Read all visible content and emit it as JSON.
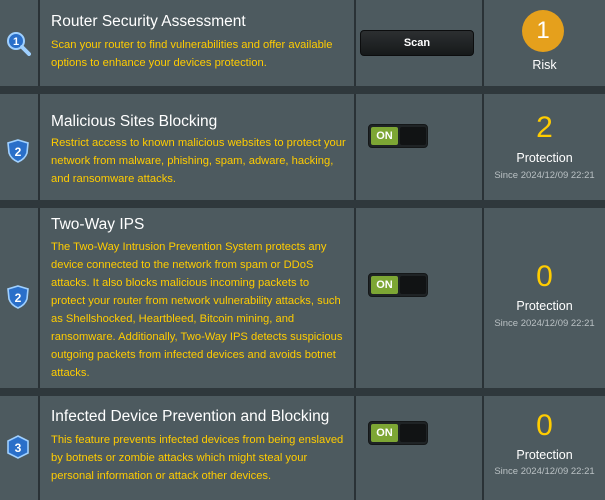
{
  "rows": [
    {
      "icon": "magnifier-1-icon",
      "icon_number": "1",
      "title": "Router Security Assessment",
      "description": "Scan your router to find vulnerabilities and offer available options to enhance your devices protection.",
      "button_label": "Scan",
      "status_value": "1",
      "status_label": "Risk"
    },
    {
      "icon": "shield-2-icon",
      "icon_number": "2",
      "title": "Malicious Sites Blocking",
      "description": "Restrict access to known malicious websites to protect your network from malware, phishing, spam, adware, hacking, and ransomware attacks.",
      "toggle_label": "ON",
      "status_value": "2",
      "status_label": "Protection",
      "since": "Since 2024/12/09 22:21"
    },
    {
      "icon": "shield-2-icon",
      "icon_number": "2",
      "title": "Two-Way IPS",
      "description": "The Two-Way Intrusion Prevention System protects any device connected to the network from spam or DDoS attacks. It also blocks malicious incoming packets to protect your router from network vulnerability attacks, such as Shellshocked, Heartbleed, Bitcoin mining, and ransomware. Additionally, Two-Way IPS detects suspicious outgoing packets from infected devices and avoids botnet attacks.",
      "toggle_label": "ON",
      "status_value": "0",
      "status_label": "Protection",
      "since": "Since 2024/12/09 22:21"
    },
    {
      "icon": "cube-3-icon",
      "icon_number": "3",
      "title": "Infected Device Prevention and Blocking",
      "description": "This feature prevents infected devices from being enslaved by botnets or zombie attacks which might steal your personal information or attack other devices.",
      "toggle_label": "ON",
      "status_value": "0",
      "status_label": "Protection",
      "since": "Since 2024/12/09 22:21"
    }
  ],
  "colors": {
    "accent_yellow": "#ffcc00",
    "risk_orange": "#e5a01c",
    "toggle_green": "#7da634",
    "panel": "#4d5a5f"
  }
}
